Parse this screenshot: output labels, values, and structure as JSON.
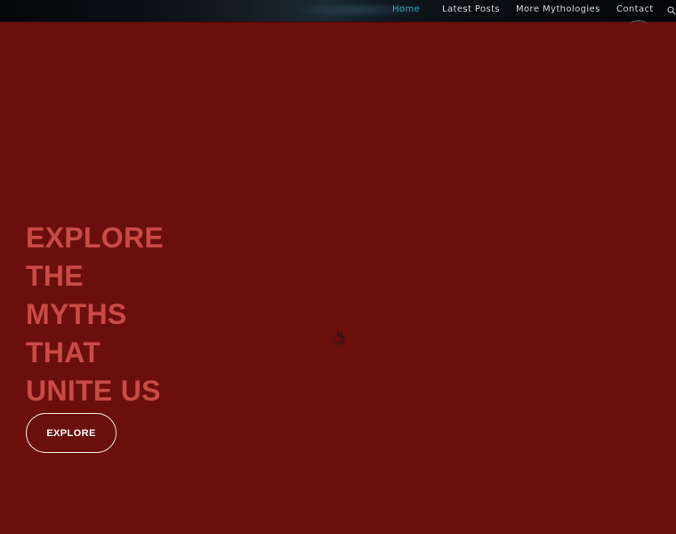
{
  "nav": {
    "items": [
      {
        "label": "Home",
        "active": true
      },
      {
        "label": "Latest Posts",
        "active": false
      },
      {
        "label": "More Mythologies",
        "active": false
      },
      {
        "label": "Contact",
        "active": false
      }
    ],
    "search_icon": "search-icon"
  },
  "hero": {
    "title_lines": [
      "EXPLORE",
      "THE",
      "MYTHS",
      "THAT",
      "UNITE US"
    ],
    "button_label": "EXPLORE",
    "loader_icon": "spinner-icon"
  },
  "colors": {
    "background": "#6b0f0d",
    "title": "#c94b46",
    "nav_active": "#35a9c6",
    "nav_text": "#d9d9d9"
  }
}
